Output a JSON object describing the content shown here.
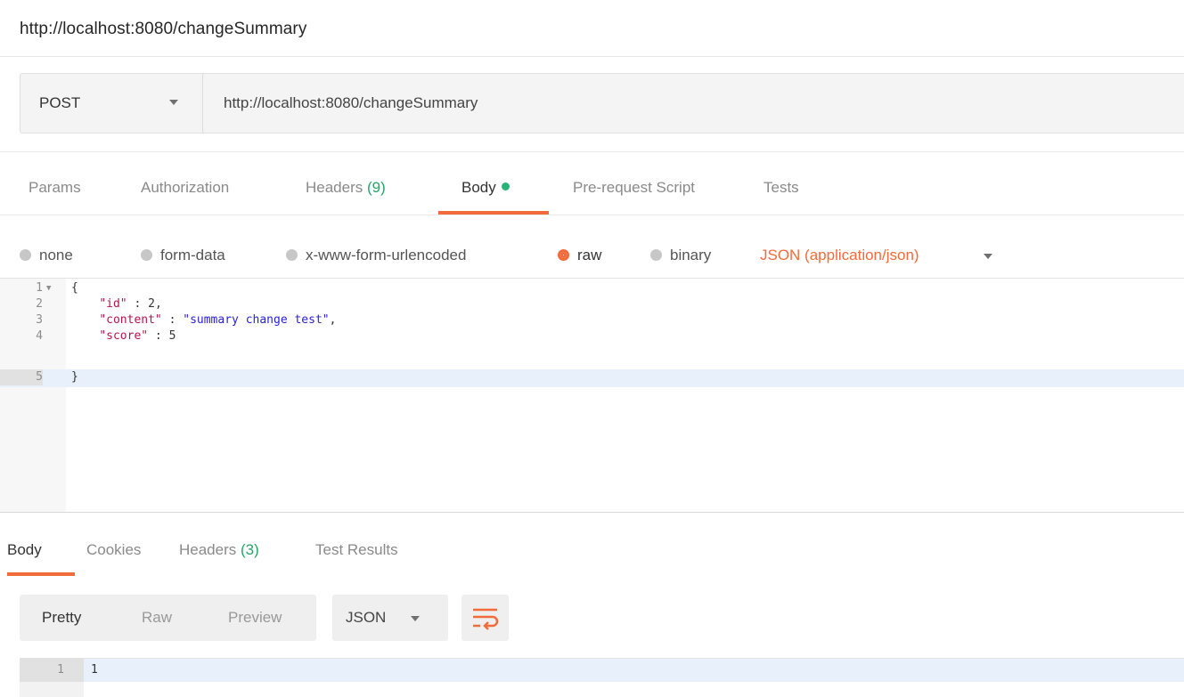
{
  "window": {
    "title": "http://localhost:8080/changeSummary"
  },
  "request": {
    "method": "POST",
    "url": "http://localhost:8080/changeSummary"
  },
  "request_tabs": {
    "params": "Params",
    "authorization": "Authorization",
    "headers": "Headers",
    "headers_count": "(9)",
    "body": "Body",
    "pre_request": "Pre-request Script",
    "tests": "Tests"
  },
  "body_types": {
    "none": "none",
    "form_data": "form-data",
    "urlencoded": "x-www-form-urlencoded",
    "raw": "raw",
    "binary": "binary",
    "content_type": "JSON (application/json)",
    "selected": "raw"
  },
  "editor": {
    "lines": [
      {
        "num": "1",
        "text": "{"
      },
      {
        "num": "2",
        "key": "\"id\"",
        "sep": " : ",
        "value": "2",
        "suffix": ","
      },
      {
        "num": "3",
        "key": "\"content\"",
        "sep": " : ",
        "value": "\"summary change test\"",
        "suffix": ","
      },
      {
        "num": "4",
        "key": "\"score\"",
        "sep": " : ",
        "value": "5",
        "suffix": ""
      },
      {
        "num": "5",
        "text": "}"
      }
    ],
    "active_line": "5"
  },
  "response_tabs": {
    "body": "Body",
    "cookies": "Cookies",
    "headers": "Headers",
    "headers_count": "(3)",
    "test_results": "Test Results"
  },
  "view_options": {
    "pretty": "Pretty",
    "raw": "Raw",
    "preview": "Preview",
    "format": "JSON"
  },
  "response": {
    "lines": [
      {
        "num": "1",
        "text": "1"
      }
    ]
  },
  "colors": {
    "accent": "#f26b3a",
    "success": "#26a567"
  }
}
